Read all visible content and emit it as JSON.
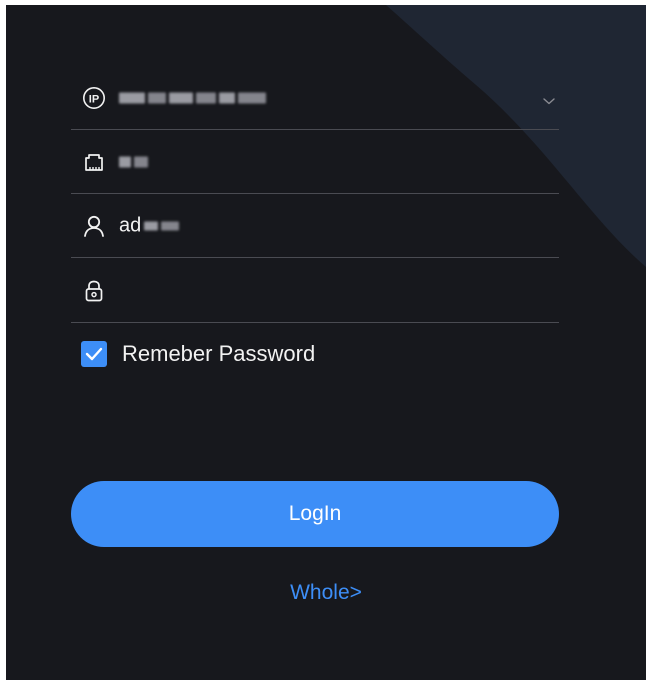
{
  "form": {
    "ip": {
      "icon": "ip-icon",
      "value_redacted": true,
      "dropdown_icon": "chevron-down-icon"
    },
    "port": {
      "icon": "ethernet-port-icon",
      "value_redacted": true
    },
    "username": {
      "icon": "user-icon",
      "value_visible": "ad",
      "value_redacted_suffix": true
    },
    "password": {
      "icon": "lock-icon",
      "value": ""
    },
    "remember": {
      "label": "Remeber Password",
      "checked": true
    }
  },
  "actions": {
    "login_label": "LogIn",
    "whole_label": "Whole>"
  },
  "colors": {
    "background": "#17181d",
    "accent": "#3d8ef7",
    "divider": "#4a4b52",
    "text": "#f2f2f2",
    "decor_shape": "#1f2633"
  }
}
